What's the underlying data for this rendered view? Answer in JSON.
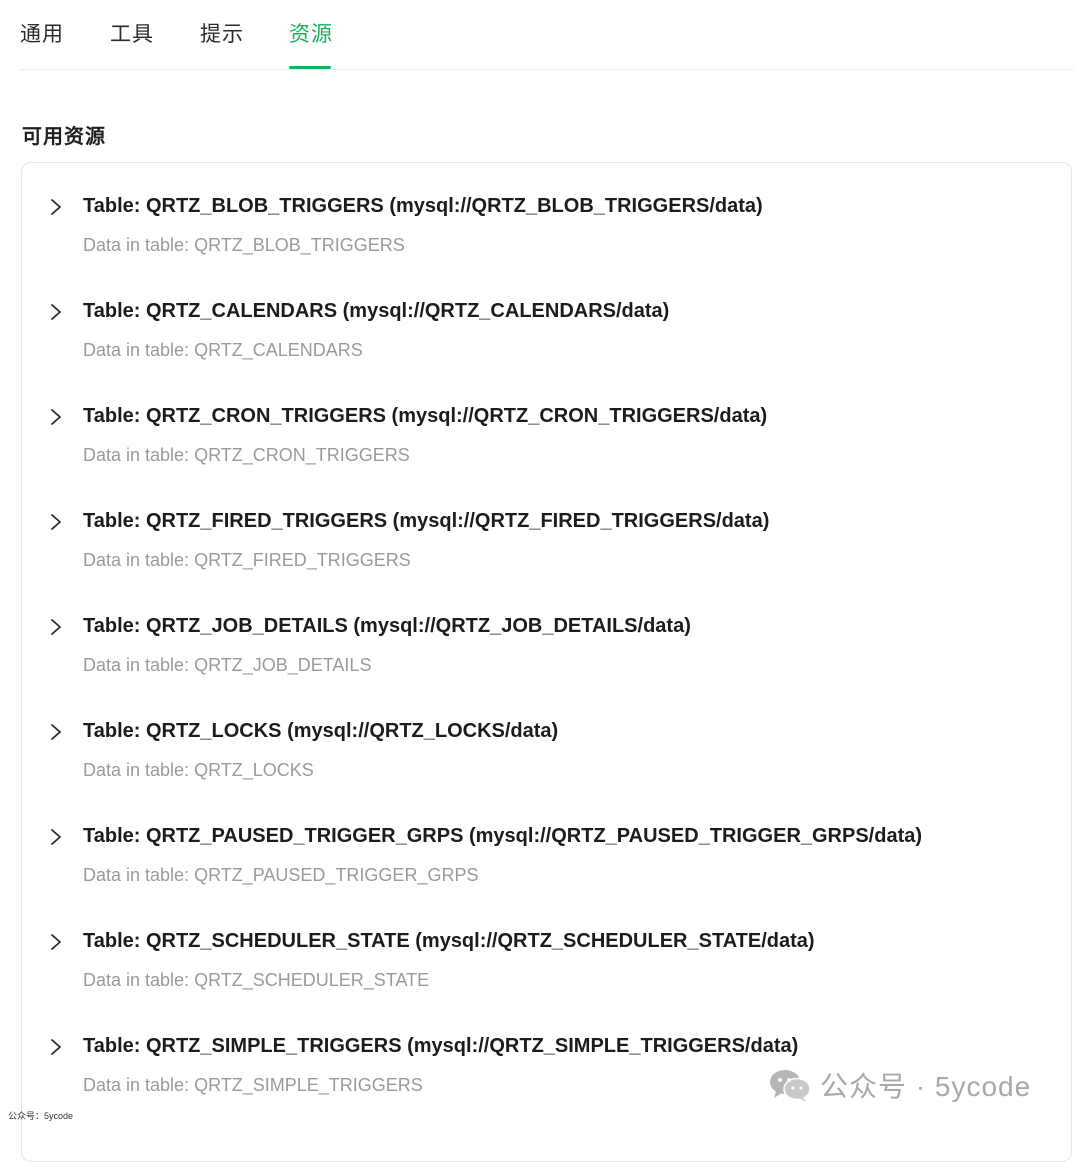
{
  "tabs": [
    {
      "label": "通用",
      "active": false
    },
    {
      "label": "工具",
      "active": false
    },
    {
      "label": "提示",
      "active": false
    },
    {
      "label": "资源",
      "active": true
    }
  ],
  "accent_color": "#16b25c",
  "section": {
    "title": "可用资源"
  },
  "resources": [
    {
      "title": "Table: QRTZ_BLOB_TRIGGERS (mysql://QRTZ_BLOB_TRIGGERS/data)",
      "description": "Data in table: QRTZ_BLOB_TRIGGERS"
    },
    {
      "title": "Table: QRTZ_CALENDARS (mysql://QRTZ_CALENDARS/data)",
      "description": "Data in table: QRTZ_CALENDARS"
    },
    {
      "title": "Table: QRTZ_CRON_TRIGGERS (mysql://QRTZ_CRON_TRIGGERS/data)",
      "description": "Data in table: QRTZ_CRON_TRIGGERS"
    },
    {
      "title": "Table: QRTZ_FIRED_TRIGGERS (mysql://QRTZ_FIRED_TRIGGERS/data)",
      "description": "Data in table: QRTZ_FIRED_TRIGGERS"
    },
    {
      "title": "Table: QRTZ_JOB_DETAILS (mysql://QRTZ_JOB_DETAILS/data)",
      "description": "Data in table: QRTZ_JOB_DETAILS"
    },
    {
      "title": "Table: QRTZ_LOCKS (mysql://QRTZ_LOCKS/data)",
      "description": "Data in table: QRTZ_LOCKS"
    },
    {
      "title": "Table: QRTZ_PAUSED_TRIGGER_GRPS (mysql://QRTZ_PAUSED_TRIGGER_GRPS/data)",
      "description": "Data in table: QRTZ_PAUSED_TRIGGER_GRPS"
    },
    {
      "title": "Table: QRTZ_SCHEDULER_STATE (mysql://QRTZ_SCHEDULER_STATE/data)",
      "description": "Data in table: QRTZ_SCHEDULER_STATE"
    },
    {
      "title": "Table: QRTZ_SIMPLE_TRIGGERS (mysql://QRTZ_SIMPLE_TRIGGERS/data)",
      "description": "Data in table: QRTZ_SIMPLE_TRIGGERS"
    }
  ],
  "icons": {
    "expand": "chevron-right-icon",
    "watermark": "wechat-icon"
  },
  "watermark": {
    "text": "公众号 · 5ycode"
  },
  "footer": {
    "text": "公众号：5ycode"
  }
}
